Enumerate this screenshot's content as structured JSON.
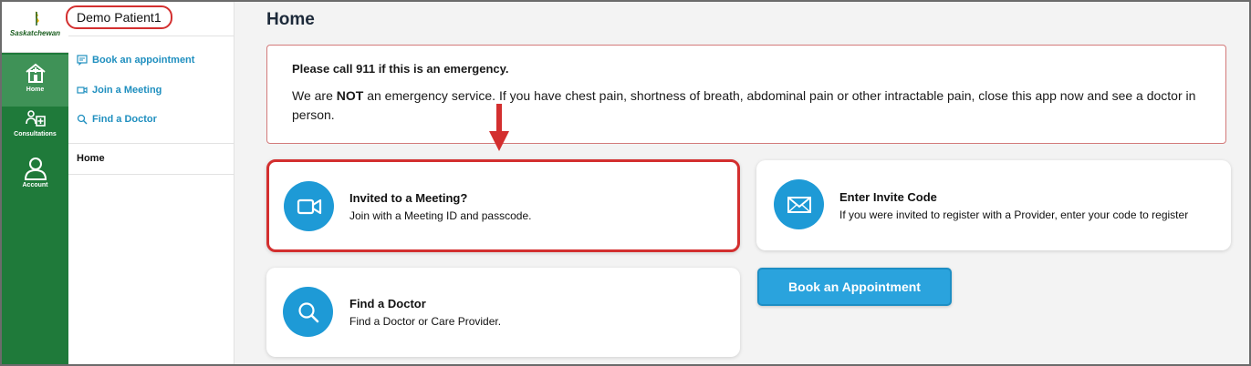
{
  "brand": {
    "name": "Saskatchewan"
  },
  "rail": {
    "items": [
      {
        "label": "Home",
        "icon": "home-icon"
      },
      {
        "label": "Consultations",
        "icon": "consultations-icon"
      },
      {
        "label": "Account",
        "icon": "account-icon"
      }
    ]
  },
  "patient": {
    "name": "Demo Patient1"
  },
  "subnav": {
    "links": [
      {
        "label": "Book an appointment",
        "icon": "calendar-chat-icon"
      },
      {
        "label": "Join a Meeting",
        "icon": "video-icon"
      },
      {
        "label": "Find a Doctor",
        "icon": "search-icon"
      }
    ],
    "home": "Home"
  },
  "page": {
    "title": "Home"
  },
  "alert": {
    "title": "Please call 911 if this is an emergency.",
    "body_prefix": "We are ",
    "body_bold": "NOT",
    "body_suffix": " an emergency service. If you have chest pain, shortness of breath, abdominal pain or other intractable pain, close this app now and see a doctor in person."
  },
  "cards": {
    "meeting": {
      "title": "Invited to a Meeting?",
      "subtitle": "Join with a Meeting ID and passcode.",
      "icon": "video-camera-icon"
    },
    "invite": {
      "title": "Enter Invite Code",
      "subtitle": "If you were invited to register with a Provider, enter your code to register",
      "icon": "envelope-icon"
    },
    "doctor": {
      "title": "Find a Doctor",
      "subtitle": "Find a Doctor or Care Provider.",
      "icon": "search-icon"
    }
  },
  "book_button": {
    "label": "Book an Appointment"
  },
  "colors": {
    "rail": "#1f7a3a",
    "accent": "#1e9ad6",
    "highlight": "#d32f2f"
  }
}
